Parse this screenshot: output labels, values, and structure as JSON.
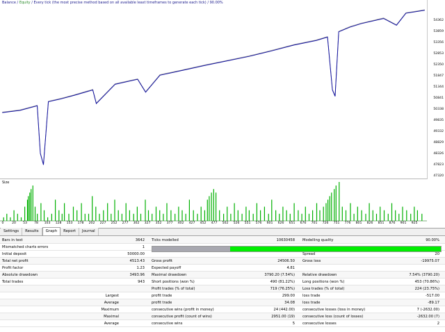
{
  "chart": {
    "caption_balance": "Balance",
    "caption_sep": " / ",
    "caption_equity": "Equity",
    "caption_rest": " / Every tick (the most precise method based on all available least timeframes to generate each tick) / 90.00%",
    "sub_caption": "Size",
    "price_ticks": [
      "54362",
      "53859",
      "53356",
      "52853",
      "52350",
      "51847",
      "51344",
      "50841",
      "50338",
      "49835",
      "49332",
      "48829",
      "48326",
      "47823",
      "47320"
    ],
    "x_ticks": [
      "0",
      "20",
      "53",
      "78",
      "103",
      "128",
      "153",
      "178",
      "202",
      "227",
      "252",
      "277",
      "302",
      "327",
      "352",
      "377",
      "402",
      "427",
      "452",
      "477",
      "502",
      "526",
      "551",
      "576",
      "601",
      "626",
      "651",
      "676",
      "701",
      "726",
      "751",
      "776",
      "801",
      "826",
      "851",
      "876",
      "901",
      "925"
    ],
    "colors": {
      "balance": "#1010a0",
      "equity": "#a0a0a0",
      "volume": "#00b000"
    }
  },
  "chart_data": [
    {
      "type": "line",
      "title": "Balance / Equity / Every tick (the most precise method based on all available least timeframes to generate each tick) / 90.00%",
      "xlabel": "",
      "ylabel": "",
      "xlim": [
        0,
        943
      ],
      "ylim": [
        47320,
        54700
      ],
      "series": [
        {
          "name": "Balance",
          "x": [
            0,
            40,
            78,
            103,
            130,
            160,
            202,
            252,
            302,
            352,
            402,
            452,
            502,
            551,
            601,
            651,
            701,
            726,
            751,
            776,
            801,
            851,
            901,
            943
          ],
          "values": [
            50000,
            50120,
            50300,
            50480,
            50640,
            50780,
            51000,
            51250,
            51470,
            51650,
            51860,
            52080,
            52280,
            52480,
            52720,
            52980,
            53180,
            53330,
            53560,
            53770,
            53920,
            54150,
            54380,
            54513
          ]
        },
        {
          "name": "Equity",
          "x": [
            0,
            40,
            78,
            85,
            92,
            103,
            130,
            160,
            202,
            210,
            252,
            302,
            320,
            352,
            402,
            452,
            502,
            551,
            601,
            651,
            701,
            726,
            737,
            743,
            751,
            776,
            801,
            851,
            880,
            901,
            943
          ],
          "values": [
            50000,
            50100,
            50300,
            48200,
            47700,
            50480,
            50600,
            50760,
            51000,
            50400,
            51250,
            51470,
            50900,
            51650,
            51860,
            52080,
            52280,
            52480,
            52720,
            52980,
            53180,
            53330,
            51000,
            50720,
            53560,
            53770,
            53920,
            54150,
            53850,
            54380,
            54513
          ]
        }
      ]
    },
    {
      "type": "bar",
      "title": "",
      "ylabel": "Size",
      "note_values": "trade size per trade (relative units)",
      "x": [
        5,
        12,
        20,
        28,
        36,
        44,
        52,
        58,
        60,
        63,
        66,
        70,
        75,
        80,
        88,
        95,
        103,
        112,
        120,
        128,
        135,
        140,
        150,
        160,
        168,
        178,
        186,
        194,
        202,
        210,
        218,
        227,
        236,
        244,
        252,
        260,
        268,
        277,
        285,
        294,
        302,
        310,
        320,
        327,
        335,
        344,
        352,
        360,
        368,
        377,
        386,
        394,
        402,
        410,
        418,
        427,
        436,
        444,
        452,
        458,
        462,
        467,
        472,
        477,
        485,
        494,
        502,
        510,
        518,
        526,
        535,
        544,
        551,
        560,
        568,
        576,
        585,
        594,
        601,
        610,
        618,
        626,
        634,
        642,
        651,
        660,
        668,
        676,
        684,
        692,
        701,
        708,
        716,
        722,
        726,
        730,
        734,
        740,
        744,
        751,
        758,
        766,
        776,
        784,
        792,
        801,
        810,
        818,
        826,
        834,
        842,
        851,
        860,
        868,
        876,
        884,
        892,
        901,
        910,
        918,
        925,
        935
      ],
      "values": [
        1,
        2,
        1,
        3,
        2,
        1,
        4,
        6,
        7,
        8,
        9,
        10,
        4,
        2,
        5,
        3,
        1,
        2,
        6,
        3,
        2,
        5,
        2,
        4,
        3,
        5,
        2,
        2,
        7,
        4,
        2,
        3,
        5,
        2,
        6,
        3,
        2,
        5,
        3,
        2,
        4,
        2,
        6,
        3,
        2,
        4,
        3,
        2,
        5,
        3,
        2,
        4,
        3,
        2,
        6,
        3,
        2,
        4,
        3,
        6,
        7,
        8,
        9,
        8,
        3,
        2,
        4,
        2,
        5,
        3,
        2,
        4,
        3,
        2,
        5,
        3,
        4,
        2,
        6,
        3,
        2,
        4,
        3,
        2,
        5,
        3,
        2,
        4,
        2,
        3,
        5,
        3,
        4,
        5,
        6,
        7,
        8,
        9,
        10,
        11,
        4,
        3,
        5,
        2,
        4,
        3,
        2,
        5,
        3,
        2,
        4,
        3,
        2,
        5,
        3,
        2,
        4,
        3,
        2,
        4,
        3,
        2
      ]
    }
  ],
  "tabs": [
    {
      "label": "Settings",
      "active": false
    },
    {
      "label": "Results",
      "active": false
    },
    {
      "label": "Graph",
      "active": true
    },
    {
      "label": "Report",
      "active": false
    },
    {
      "label": "Journal",
      "active": false
    }
  ],
  "report": {
    "bars_in_test_label": "Bars in test",
    "bars_in_test": "3642",
    "ticks_modelled_label": "Ticks modelled",
    "ticks_modelled": "10630458",
    "modelling_quality_label": "Modelling quality",
    "modelling_quality": "90.00%",
    "mismatched_label": "Mismatched charts errors",
    "mismatched": "1",
    "initial_deposit_label": "Initial deposit",
    "initial_deposit": "50000.00",
    "spread_label": "Spread",
    "spread": "20",
    "total_net_profit_label": "Total net profit",
    "total_net_profit": "4513.43",
    "gross_profit_label": "Gross profit",
    "gross_profit": "24506.50",
    "gross_loss_label": "Gross loss",
    "gross_loss": "-19975.07",
    "profit_factor_label": "Profit factor",
    "profit_factor": "1.23",
    "expected_payoff_label": "Expected payoff",
    "expected_payoff": "4.81",
    "absolute_drawdown_label": "Absolute drawdown",
    "absolute_drawdown": "3493.96",
    "maximal_drawdown_label": "Maximal drawdown",
    "maximal_drawdown": "3790.20 (7.54%)",
    "relative_drawdown_label": "Relative drawdown",
    "relative_drawdown": "7.54% (3790.20)",
    "total_trades_label": "Total trades",
    "total_trades": "943",
    "short_positions_label": "Short positions (won %)",
    "short_positions": "490 (81.22%)",
    "long_positions_label": "Long positions (won %)",
    "long_positions": "453 (70.86%)",
    "profit_trades_label": "Profit trades (% of total)",
    "profit_trades": "719 (76.25%)",
    "loss_trades_label": "Loss trades (% of total)",
    "loss_trades": "224 (23.75%)",
    "largest_label": "Largest",
    "largest_profit_label": "profit trade",
    "largest_profit": "299.00",
    "largest_loss_label": "loss trade",
    "largest_loss": "-517.00",
    "average_label": "Average",
    "average_profit_label": "profit trade",
    "average_profit": "34.08",
    "average_loss_label": "loss trade",
    "average_loss": "-89.17",
    "maximum_label": "Maximum",
    "max_cons_wins_label": "consecutive wins (profit in money)",
    "max_cons_wins": "24 (442.00)",
    "max_cons_losses_label": "consecutive losses (loss in money)",
    "max_cons_losses": "7 (-2632.00)",
    "maximal_label": "Maximal",
    "maximal_cons_profit_label": "consecutive profit (count of wins)",
    "maximal_cons_profit": "2951.00 (19)",
    "maximal_cons_loss_label": "consecutive loss (count of losses)",
    "maximal_cons_loss": "-2632.00 (7)",
    "average2_label": "Average",
    "avg_cons_wins_label": "consecutive wins",
    "avg_cons_wins": "5",
    "avg_cons_losses_label": "consecutive losses",
    "avg_cons_losses": "2",
    "quality_fraction": 0.9,
    "quality_grey_fraction": 0.27
  }
}
